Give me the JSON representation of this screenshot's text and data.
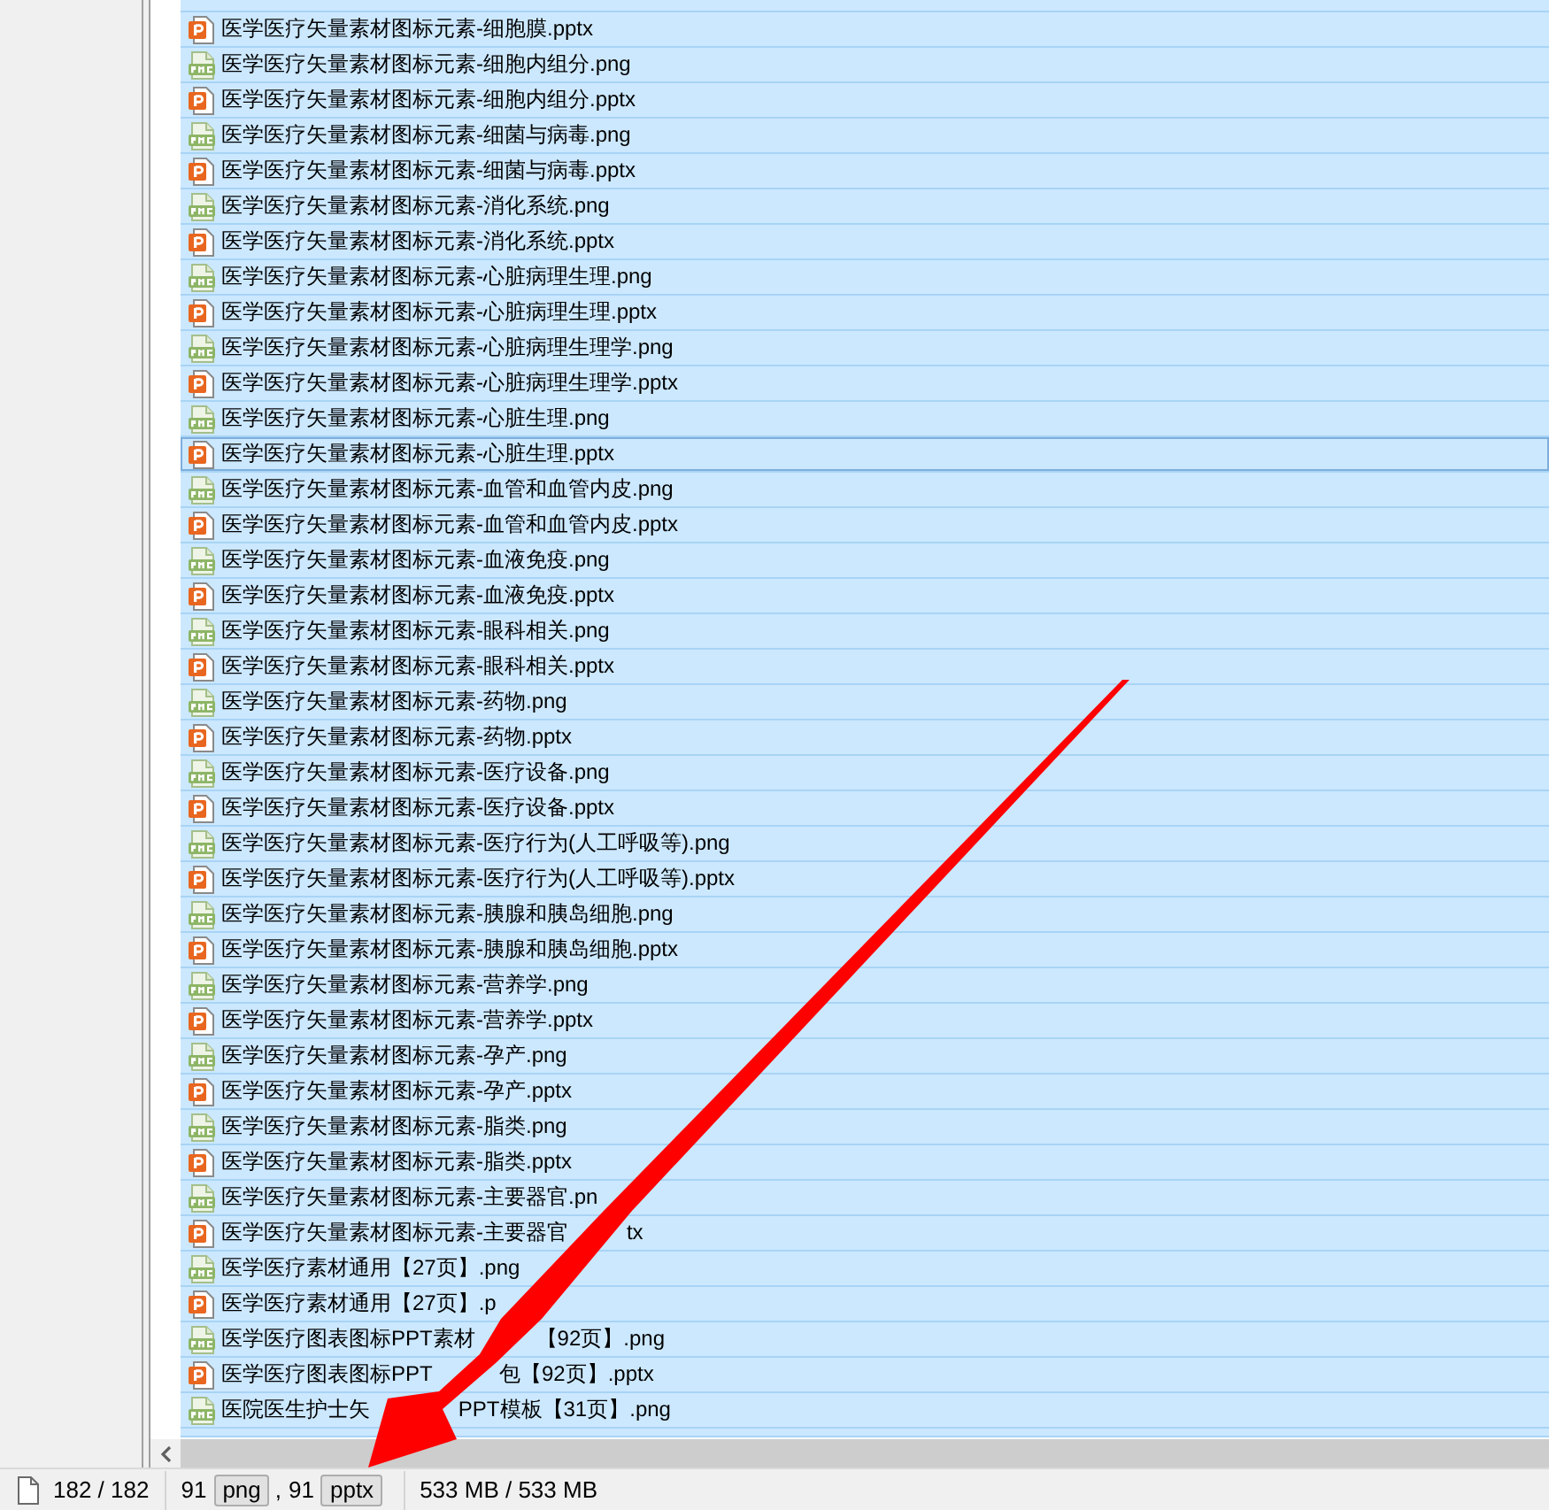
{
  "file_list": {
    "rows": [
      {
        "kind": "pptx",
        "name": "医学医疗矢量素材图标元素-细胞膜.pptx",
        "selected": true,
        "focused": false
      },
      {
        "kind": "png",
        "name": "医学医疗矢量素材图标元素-细胞内组分.png",
        "selected": true,
        "focused": false
      },
      {
        "kind": "pptx",
        "name": "医学医疗矢量素材图标元素-细胞内组分.pptx",
        "selected": true,
        "focused": false
      },
      {
        "kind": "png",
        "name": "医学医疗矢量素材图标元素-细菌与病毒.png",
        "selected": true,
        "focused": false
      },
      {
        "kind": "pptx",
        "name": "医学医疗矢量素材图标元素-细菌与病毒.pptx",
        "selected": true,
        "focused": false
      },
      {
        "kind": "png",
        "name": "医学医疗矢量素材图标元素-消化系统.png",
        "selected": true,
        "focused": false
      },
      {
        "kind": "pptx",
        "name": "医学医疗矢量素材图标元素-消化系统.pptx",
        "selected": true,
        "focused": false
      },
      {
        "kind": "png",
        "name": "医学医疗矢量素材图标元素-心脏病理生理.png",
        "selected": true,
        "focused": false
      },
      {
        "kind": "pptx",
        "name": "医学医疗矢量素材图标元素-心脏病理生理.pptx",
        "selected": true,
        "focused": false
      },
      {
        "kind": "png",
        "name": "医学医疗矢量素材图标元素-心脏病理生理学.png",
        "selected": true,
        "focused": false
      },
      {
        "kind": "pptx",
        "name": "医学医疗矢量素材图标元素-心脏病理生理学.pptx",
        "selected": true,
        "focused": false
      },
      {
        "kind": "png",
        "name": "医学医疗矢量素材图标元素-心脏生理.png",
        "selected": true,
        "focused": false
      },
      {
        "kind": "pptx",
        "name": "医学医疗矢量素材图标元素-心脏生理.pptx",
        "selected": true,
        "focused": true
      },
      {
        "kind": "png",
        "name": "医学医疗矢量素材图标元素-血管和血管内皮.png",
        "selected": true,
        "focused": false
      },
      {
        "kind": "pptx",
        "name": "医学医疗矢量素材图标元素-血管和血管内皮.pptx",
        "selected": true,
        "focused": false
      },
      {
        "kind": "png",
        "name": "医学医疗矢量素材图标元素-血液免疫.png",
        "selected": true,
        "focused": false
      },
      {
        "kind": "pptx",
        "name": "医学医疗矢量素材图标元素-血液免疫.pptx",
        "selected": true,
        "focused": false
      },
      {
        "kind": "png",
        "name": "医学医疗矢量素材图标元素-眼科相关.png",
        "selected": true,
        "focused": false
      },
      {
        "kind": "pptx",
        "name": "医学医疗矢量素材图标元素-眼科相关.pptx",
        "selected": true,
        "focused": false
      },
      {
        "kind": "png",
        "name": "医学医疗矢量素材图标元素-药物.png",
        "selected": true,
        "focused": false
      },
      {
        "kind": "pptx",
        "name": "医学医疗矢量素材图标元素-药物.pptx",
        "selected": true,
        "focused": false
      },
      {
        "kind": "png",
        "name": "医学医疗矢量素材图标元素-医疗设备.png",
        "selected": true,
        "focused": false
      },
      {
        "kind": "pptx",
        "name": "医学医疗矢量素材图标元素-医疗设备.pptx",
        "selected": true,
        "focused": false
      },
      {
        "kind": "png",
        "name": "医学医疗矢量素材图标元素-医疗行为(人工呼吸等).png",
        "selected": true,
        "focused": false
      },
      {
        "kind": "pptx",
        "name": "医学医疗矢量素材图标元素-医疗行为(人工呼吸等).pptx",
        "selected": true,
        "focused": false
      },
      {
        "kind": "png",
        "name": "医学医疗矢量素材图标元素-胰腺和胰岛细胞.png",
        "selected": true,
        "focused": false
      },
      {
        "kind": "pptx",
        "name": "医学医疗矢量素材图标元素-胰腺和胰岛细胞.pptx",
        "selected": true,
        "focused": false
      },
      {
        "kind": "png",
        "name": "医学医疗矢量素材图标元素-营养学.png",
        "selected": true,
        "focused": false
      },
      {
        "kind": "pptx",
        "name": "医学医疗矢量素材图标元素-营养学.pptx",
        "selected": true,
        "focused": false
      },
      {
        "kind": "png",
        "name": "医学医疗矢量素材图标元素-孕产.png",
        "selected": true,
        "focused": false
      },
      {
        "kind": "pptx",
        "name": "医学医疗矢量素材图标元素-孕产.pptx",
        "selected": true,
        "focused": false
      },
      {
        "kind": "png",
        "name": "医学医疗矢量素材图标元素-脂类.png",
        "selected": true,
        "focused": false
      },
      {
        "kind": "pptx",
        "name": "医学医疗矢量素材图标元素-脂类.pptx",
        "selected": true,
        "focused": false
      },
      {
        "kind": "png",
        "name": "医学医疗矢量素材图标元素-主要器官.pn",
        "selected": true,
        "focused": false
      },
      {
        "kind": "pptx",
        "name": "医学医疗矢量素材图标元素-主要器官",
        "name_after": "tx",
        "selected": true,
        "focused": false
      },
      {
        "kind": "png",
        "name": "医学医疗素材通用【27页】.png",
        "selected": true,
        "focused": false
      },
      {
        "kind": "pptx",
        "name": "医学医疗素材通用【27页】.p",
        "selected": true,
        "focused": false
      },
      {
        "kind": "png",
        "name": "医学医疗图表图标PPT素材",
        "name_after": "【92页】.png",
        "selected": true,
        "focused": false
      },
      {
        "kind": "pptx",
        "name": "医学医疗图表图标PPT",
        "name_after": "包【92页】.pptx",
        "selected": true,
        "focused": false
      },
      {
        "kind": "png",
        "name": "医院医生护士矢",
        "name_after": "PPT模板【31页】.png",
        "selected": true,
        "focused": false
      }
    ]
  },
  "annotations": [
    {
      "kind": "arrow"
    }
  ],
  "status_bar": {
    "count": "182 / 182",
    "types": [
      {
        "count": "91",
        "label": "png"
      },
      {
        "count": "91",
        "label": "pptx"
      }
    ],
    "type_separator": ",",
    "size": "533 MB / 533 MB"
  }
}
